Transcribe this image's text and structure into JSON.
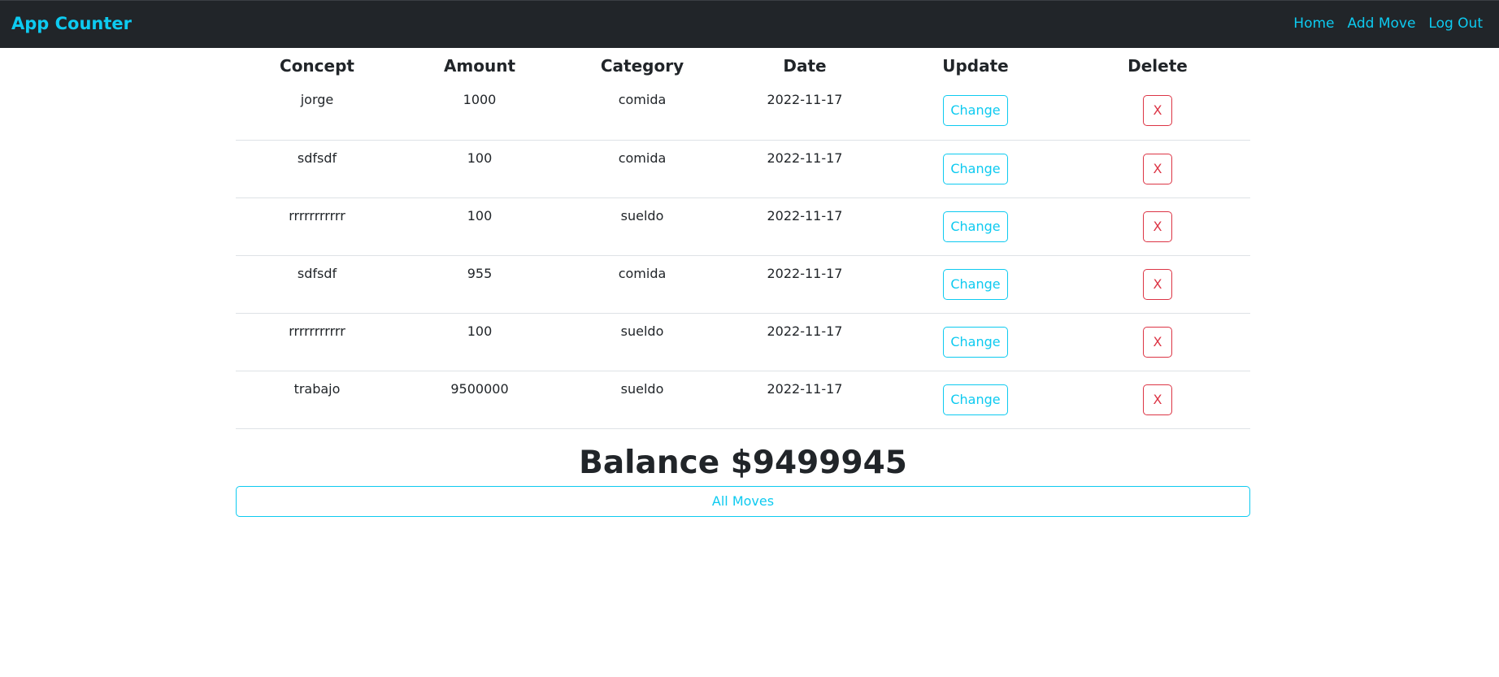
{
  "navbar": {
    "brand": "App Counter",
    "links": [
      "Home",
      "Add Move",
      "Log Out"
    ]
  },
  "table": {
    "headers": [
      "Concept",
      "Amount",
      "Category",
      "Date",
      "Update",
      "Delete"
    ],
    "rows": [
      {
        "concept": "jorge",
        "amount": "1000",
        "category": "comida",
        "date": "2022-11-17",
        "update_label": "Change",
        "delete_label": "X"
      },
      {
        "concept": "sdfsdf",
        "amount": "100",
        "category": "comida",
        "date": "2022-11-17",
        "update_label": "Change",
        "delete_label": "X"
      },
      {
        "concept": "rrrrrrrrrrr",
        "amount": "100",
        "category": "sueldo",
        "date": "2022-11-17",
        "update_label": "Change",
        "delete_label": "X"
      },
      {
        "concept": "sdfsdf",
        "amount": "955",
        "category": "comida",
        "date": "2022-11-17",
        "update_label": "Change",
        "delete_label": "X"
      },
      {
        "concept": "rrrrrrrrrrr",
        "amount": "100",
        "category": "sueldo",
        "date": "2022-11-17",
        "update_label": "Change",
        "delete_label": "X"
      },
      {
        "concept": "trabajo",
        "amount": "9500000",
        "category": "sueldo",
        "date": "2022-11-17",
        "update_label": "Change",
        "delete_label": "X"
      }
    ]
  },
  "balance": {
    "text": "Balance $9499945"
  },
  "footer": {
    "all_moves_label": "All Moves"
  },
  "colors": {
    "navbar_bg": "#212529",
    "accent_info": "#0dcaf0",
    "danger": "#dc3545"
  }
}
